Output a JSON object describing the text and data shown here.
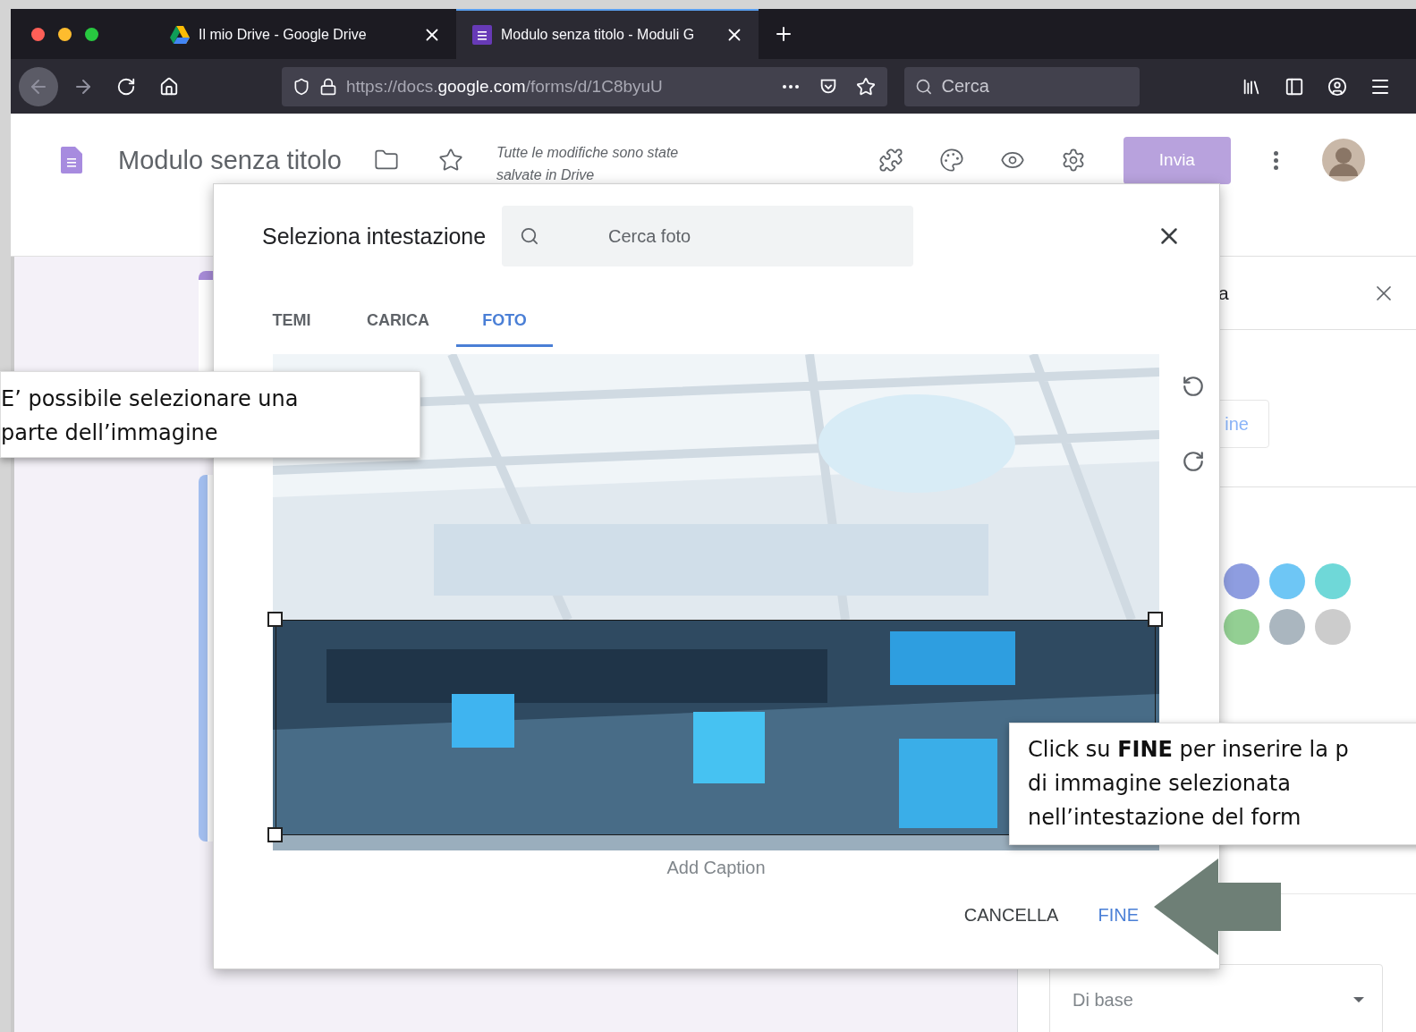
{
  "browser": {
    "tabs": [
      {
        "title": "Il mio Drive - Google Drive",
        "selected": false
      },
      {
        "title": "Modulo senza titolo - Moduli G",
        "selected": true
      }
    ],
    "url": "https://docs.**google.com**/forms/d/1C8byuU",
    "search": {
      "placeholder": "Cerca"
    }
  },
  "forms_header": {
    "title": "Modulo senza titolo",
    "save_status": "Tutte le modifiche sono state salvate in Drive",
    "send_button": "Invia"
  },
  "side_panel": {
    "title": "a",
    "button": "ine",
    "colors": [
      {
        "color": "#8e9de0"
      },
      {
        "color": "#6ec6f5"
      },
      {
        "color": "#6fd8d8"
      },
      {
        "color": "#93cf93"
      },
      {
        "color": "#aab6bf"
      },
      {
        "color": "#cccccc"
      }
    ],
    "style_select": "Di base"
  },
  "dialog": {
    "title": "Seleziona intestazione",
    "search": {
      "placeholder": "Cerca foto"
    },
    "tabs": [
      {
        "label": "TEMI",
        "selected": false
      },
      {
        "label": "CARICA",
        "selected": false
      },
      {
        "label": "FOTO",
        "selected": true
      }
    ],
    "caption": {
      "placeholder": "Add Caption"
    },
    "buttons": [
      {
        "label": "CANCELLA",
        "kind": "secondary"
      },
      {
        "label": "FINE",
        "kind": "primary"
      }
    ]
  },
  "callouts": [
    {
      "lines": [
        "E’ possibile selezionare una",
        "parte dell’immagine"
      ]
    },
    {
      "lines": [
        "Click su **FINE** per inserire la p",
        "di immagine selezionata",
        "nell’intestazione del form"
      ]
    }
  ]
}
